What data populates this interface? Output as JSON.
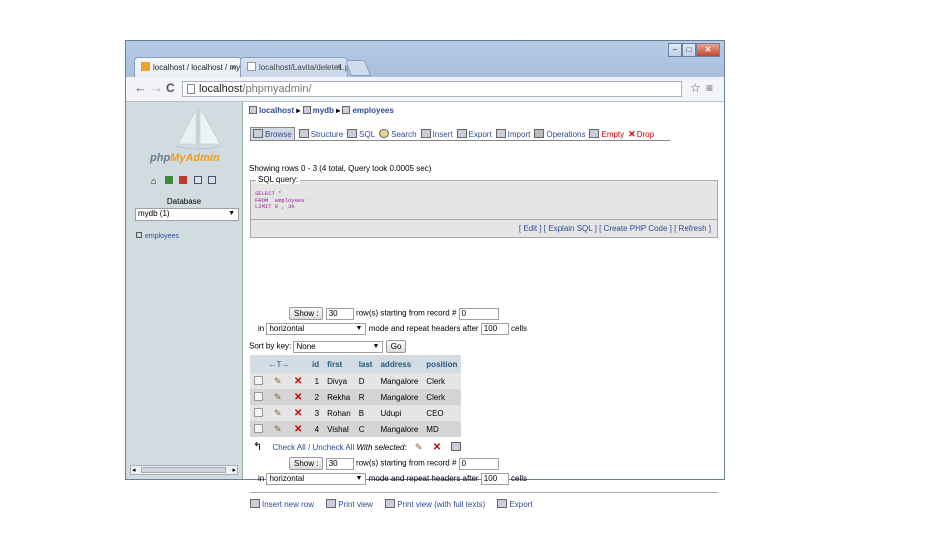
{
  "browser": {
    "tabs": [
      {
        "label": "localhost / localhost / my",
        "close": "×"
      },
      {
        "label": "localhost/Lavita/delete1.p",
        "close": "×"
      }
    ],
    "window_buttons": {
      "minimize": "–",
      "maximize": "□",
      "close": "✕"
    },
    "url_host": "localhost",
    "url_path": "/phpmyadmin/",
    "nav": {
      "back": "←",
      "forward": "→",
      "reload": "C",
      "star": "☆",
      "menu": "≡"
    }
  },
  "sidebar": {
    "logo_php": "php",
    "logo_myadmin": "MyAdmin",
    "database_label": "Database",
    "database_selected": "mydb (1)",
    "tables": [
      "employees"
    ],
    "scroll_left": "◂",
    "scroll_right": "▸"
  },
  "breadcrumb": {
    "server": "localhost",
    "database": "mydb",
    "table": "employees",
    "sep": "▸"
  },
  "menu": [
    {
      "label": "Browse"
    },
    {
      "label": "Structure"
    },
    {
      "label": "SQL"
    },
    {
      "label": "Search"
    },
    {
      "label": "Insert"
    },
    {
      "label": "Export"
    },
    {
      "label": "Import"
    },
    {
      "label": "Operations"
    },
    {
      "label": "Empty"
    },
    {
      "label": "Drop"
    }
  ],
  "status_message": "Showing rows 0 - 3 (4 total, Query took 0.0005 sec)",
  "sql_query": {
    "legend": "SQL query:",
    "line1": "SELECT *",
    "line2": "FROM `employees`",
    "line3": "LIMIT 0 , 30",
    "actions": "[ Edit ] [ Explain SQL ] [ Create PHP Code ] [ Refresh ]"
  },
  "navigation": {
    "show_button": "Show :",
    "rows_value": "30",
    "rows_text": "row(s) starting from record #",
    "start_value": "0",
    "in_text": "in",
    "mode_value": "horizontal",
    "mode_text": "mode and repeat headers after",
    "repeat_value": "100",
    "cells_text": "cells"
  },
  "sort": {
    "label": "Sort by key:",
    "value": "None",
    "go": "Go"
  },
  "table": {
    "arrows": "←T→",
    "columns": [
      "id",
      "first",
      "last",
      "address",
      "position"
    ],
    "rows": [
      [
        "1",
        "Divya",
        "D",
        "Mangalore",
        "Clerk"
      ],
      [
        "2",
        "Rekha",
        "R",
        "Mangalore",
        "Clerk"
      ],
      [
        "3",
        "Rohan",
        "B",
        "Udupi",
        "CEO"
      ],
      [
        "4",
        "Vishal",
        "C",
        "Mangalore",
        "MD"
      ]
    ]
  },
  "bulk": {
    "check_all": "Check All / Uncheck All",
    "with_selected": "With selected:"
  },
  "footer_links": [
    "Insert new row",
    "Print view",
    "Print view (with full texts)",
    "Export"
  ]
}
